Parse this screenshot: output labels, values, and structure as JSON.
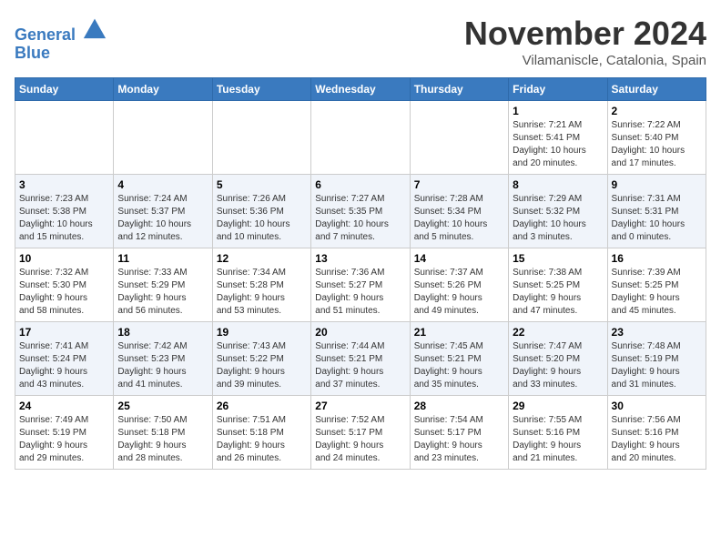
{
  "header": {
    "logo_line1": "General",
    "logo_line2": "Blue",
    "month_title": "November 2024",
    "location": "Vilamaniscle, Catalonia, Spain"
  },
  "days_of_week": [
    "Sunday",
    "Monday",
    "Tuesday",
    "Wednesday",
    "Thursday",
    "Friday",
    "Saturday"
  ],
  "weeks": [
    [
      {
        "day": "",
        "info": ""
      },
      {
        "day": "",
        "info": ""
      },
      {
        "day": "",
        "info": ""
      },
      {
        "day": "",
        "info": ""
      },
      {
        "day": "",
        "info": ""
      },
      {
        "day": "1",
        "info": "Sunrise: 7:21 AM\nSunset: 5:41 PM\nDaylight: 10 hours\nand 20 minutes."
      },
      {
        "day": "2",
        "info": "Sunrise: 7:22 AM\nSunset: 5:40 PM\nDaylight: 10 hours\nand 17 minutes."
      }
    ],
    [
      {
        "day": "3",
        "info": "Sunrise: 7:23 AM\nSunset: 5:38 PM\nDaylight: 10 hours\nand 15 minutes."
      },
      {
        "day": "4",
        "info": "Sunrise: 7:24 AM\nSunset: 5:37 PM\nDaylight: 10 hours\nand 12 minutes."
      },
      {
        "day": "5",
        "info": "Sunrise: 7:26 AM\nSunset: 5:36 PM\nDaylight: 10 hours\nand 10 minutes."
      },
      {
        "day": "6",
        "info": "Sunrise: 7:27 AM\nSunset: 5:35 PM\nDaylight: 10 hours\nand 7 minutes."
      },
      {
        "day": "7",
        "info": "Sunrise: 7:28 AM\nSunset: 5:34 PM\nDaylight: 10 hours\nand 5 minutes."
      },
      {
        "day": "8",
        "info": "Sunrise: 7:29 AM\nSunset: 5:32 PM\nDaylight: 10 hours\nand 3 minutes."
      },
      {
        "day": "9",
        "info": "Sunrise: 7:31 AM\nSunset: 5:31 PM\nDaylight: 10 hours\nand 0 minutes."
      }
    ],
    [
      {
        "day": "10",
        "info": "Sunrise: 7:32 AM\nSunset: 5:30 PM\nDaylight: 9 hours\nand 58 minutes."
      },
      {
        "day": "11",
        "info": "Sunrise: 7:33 AM\nSunset: 5:29 PM\nDaylight: 9 hours\nand 56 minutes."
      },
      {
        "day": "12",
        "info": "Sunrise: 7:34 AM\nSunset: 5:28 PM\nDaylight: 9 hours\nand 53 minutes."
      },
      {
        "day": "13",
        "info": "Sunrise: 7:36 AM\nSunset: 5:27 PM\nDaylight: 9 hours\nand 51 minutes."
      },
      {
        "day": "14",
        "info": "Sunrise: 7:37 AM\nSunset: 5:26 PM\nDaylight: 9 hours\nand 49 minutes."
      },
      {
        "day": "15",
        "info": "Sunrise: 7:38 AM\nSunset: 5:25 PM\nDaylight: 9 hours\nand 47 minutes."
      },
      {
        "day": "16",
        "info": "Sunrise: 7:39 AM\nSunset: 5:25 PM\nDaylight: 9 hours\nand 45 minutes."
      }
    ],
    [
      {
        "day": "17",
        "info": "Sunrise: 7:41 AM\nSunset: 5:24 PM\nDaylight: 9 hours\nand 43 minutes."
      },
      {
        "day": "18",
        "info": "Sunrise: 7:42 AM\nSunset: 5:23 PM\nDaylight: 9 hours\nand 41 minutes."
      },
      {
        "day": "19",
        "info": "Sunrise: 7:43 AM\nSunset: 5:22 PM\nDaylight: 9 hours\nand 39 minutes."
      },
      {
        "day": "20",
        "info": "Sunrise: 7:44 AM\nSunset: 5:21 PM\nDaylight: 9 hours\nand 37 minutes."
      },
      {
        "day": "21",
        "info": "Sunrise: 7:45 AM\nSunset: 5:21 PM\nDaylight: 9 hours\nand 35 minutes."
      },
      {
        "day": "22",
        "info": "Sunrise: 7:47 AM\nSunset: 5:20 PM\nDaylight: 9 hours\nand 33 minutes."
      },
      {
        "day": "23",
        "info": "Sunrise: 7:48 AM\nSunset: 5:19 PM\nDaylight: 9 hours\nand 31 minutes."
      }
    ],
    [
      {
        "day": "24",
        "info": "Sunrise: 7:49 AM\nSunset: 5:19 PM\nDaylight: 9 hours\nand 29 minutes."
      },
      {
        "day": "25",
        "info": "Sunrise: 7:50 AM\nSunset: 5:18 PM\nDaylight: 9 hours\nand 28 minutes."
      },
      {
        "day": "26",
        "info": "Sunrise: 7:51 AM\nSunset: 5:18 PM\nDaylight: 9 hours\nand 26 minutes."
      },
      {
        "day": "27",
        "info": "Sunrise: 7:52 AM\nSunset: 5:17 PM\nDaylight: 9 hours\nand 24 minutes."
      },
      {
        "day": "28",
        "info": "Sunrise: 7:54 AM\nSunset: 5:17 PM\nDaylight: 9 hours\nand 23 minutes."
      },
      {
        "day": "29",
        "info": "Sunrise: 7:55 AM\nSunset: 5:16 PM\nDaylight: 9 hours\nand 21 minutes."
      },
      {
        "day": "30",
        "info": "Sunrise: 7:56 AM\nSunset: 5:16 PM\nDaylight: 9 hours\nand 20 minutes."
      }
    ]
  ]
}
